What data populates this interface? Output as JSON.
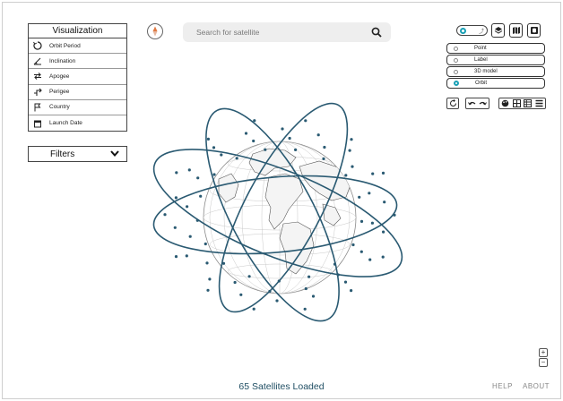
{
  "visualization": {
    "title": "Visualization",
    "items": [
      {
        "label": "Orbit Period",
        "icon": "orbit-period-icon"
      },
      {
        "label": "Inclination",
        "icon": "inclination-icon"
      },
      {
        "label": "Apogee",
        "icon": "apogee-icon"
      },
      {
        "label": "Perigee",
        "icon": "perigee-icon"
      },
      {
        "label": "Country",
        "icon": "flag-icon"
      },
      {
        "label": "Launch Date",
        "icon": "calendar-icon"
      }
    ]
  },
  "filters": {
    "label": "Filters"
  },
  "search": {
    "placeholder": "Search for satellite"
  },
  "layers": {
    "options": [
      {
        "label": "Point",
        "selected": false
      },
      {
        "label": "Label",
        "selected": false
      },
      {
        "label": "3D model",
        "selected": false
      },
      {
        "label": "Orbit",
        "selected": true
      }
    ]
  },
  "colors": {
    "accent": "#1aa0b5",
    "orbit": "#2a5a72",
    "status": "#1f4e63"
  },
  "status": {
    "text": "65 Satellites Loaded"
  },
  "footer": {
    "help": "HELP",
    "about": "ABOUT"
  },
  "zoom": {
    "in": "+",
    "out": "−"
  }
}
